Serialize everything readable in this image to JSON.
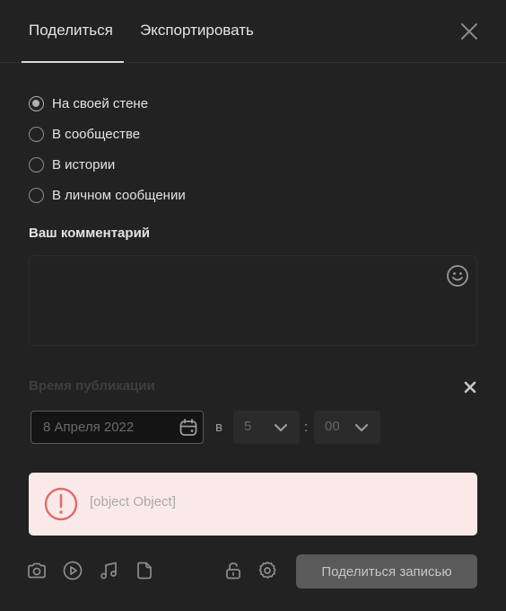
{
  "tabs": [
    {
      "label": "Поделиться",
      "active": true
    },
    {
      "label": "Экспортировать",
      "active": false
    }
  ],
  "share_targets": [
    {
      "label": "На своей стене",
      "checked": true
    },
    {
      "label": "В сообществе",
      "checked": false
    },
    {
      "label": "В истории",
      "checked": false
    },
    {
      "label": "В личном сообщении",
      "checked": false
    }
  ],
  "comment": {
    "label": "Ваш комментарий",
    "value": ""
  },
  "publish_time": {
    "label": "Время публикации",
    "date": "8 Апреля 2022",
    "at": "в",
    "hour": "5",
    "separator": ":",
    "minute": "00"
  },
  "error": {
    "message": "[object Object]"
  },
  "toolbar": {
    "icons": [
      "camera-icon",
      "video-icon",
      "music-icon",
      "document-icon",
      "lock-icon",
      "settings-icon"
    ],
    "submit_label": "Поделиться записью"
  },
  "colors": {
    "background": "#222222",
    "error_background": "#fbe9e9",
    "error_icon": "#e06c6c",
    "submit_button": "#5a5a5a"
  }
}
